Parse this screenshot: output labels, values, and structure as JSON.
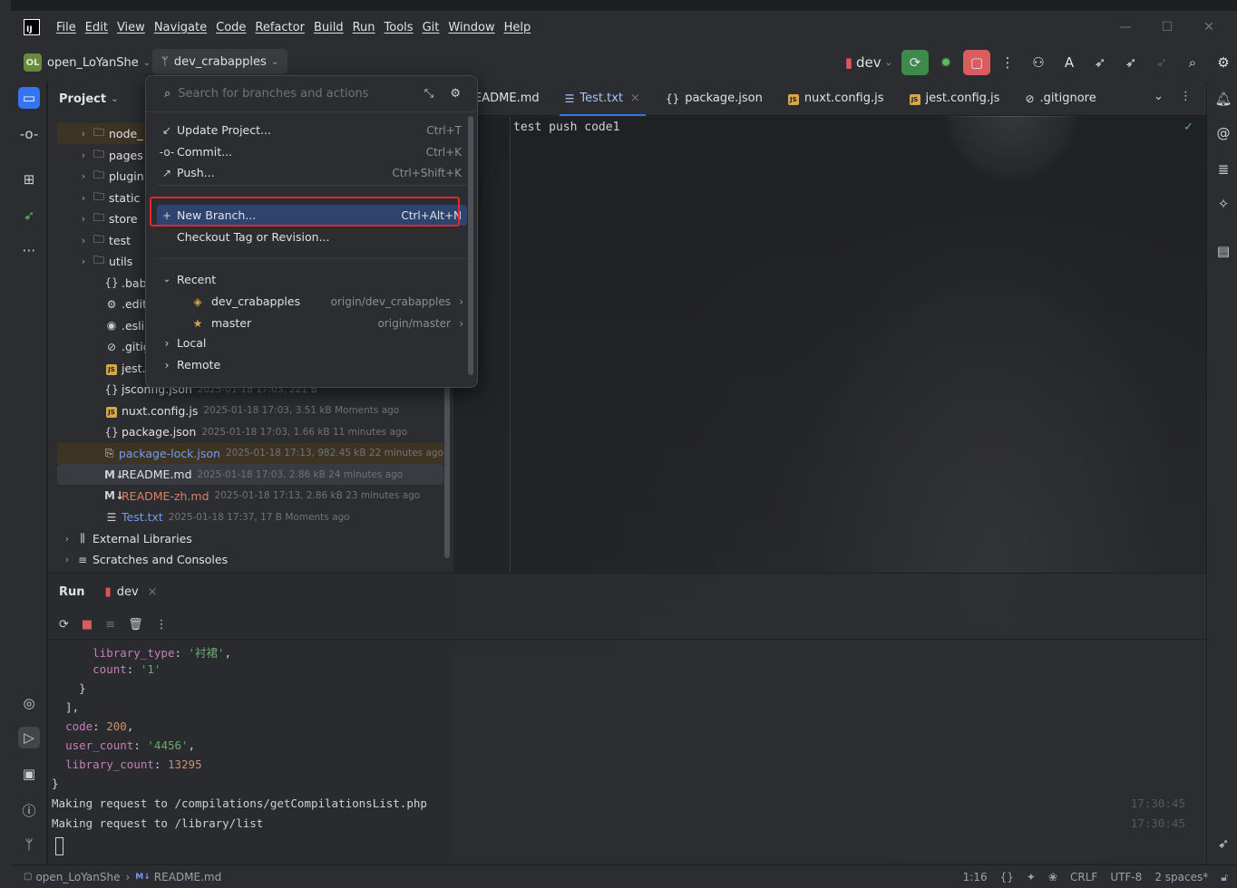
{
  "menu": [
    "File",
    "Edit",
    "View",
    "Navigate",
    "Code",
    "Refactor",
    "Build",
    "Run",
    "Tools",
    "Git",
    "Window",
    "Help"
  ],
  "toolbar": {
    "project_badge": "OL",
    "project_name": "open_LoYanShe",
    "branch_name": "dev_crabapples",
    "run_config": "dev"
  },
  "project_panel": {
    "title": "Project",
    "tree": [
      {
        "name": "node_",
        "icon": "folder-icon",
        "chev": "›",
        "meta": "",
        "hl": true
      },
      {
        "name": "pages",
        "icon": "folder-icon",
        "chev": "›",
        "meta": ""
      },
      {
        "name": "plugin",
        "icon": "folder-icon",
        "chev": "›",
        "meta": ""
      },
      {
        "name": "static",
        "icon": "folder-icon",
        "chev": "›",
        "meta": ""
      },
      {
        "name": "store",
        "icon": "folder-icon",
        "chev": "›",
        "meta": ""
      },
      {
        "name": "test",
        "icon": "folder-icon",
        "chev": "›",
        "meta": ""
      },
      {
        "name": "utils",
        "icon": "folder-icon",
        "chev": "›",
        "meta": ""
      },
      {
        "name": ".babel",
        "icon": "braces-icon",
        "chev": "",
        "meta": ""
      },
      {
        "name": ".editor",
        "icon": "gear-icon",
        "chev": "",
        "meta": ""
      },
      {
        "name": ".eslintr",
        "icon": "eslint-icon",
        "chev": "",
        "meta": ""
      },
      {
        "name": ".gitign",
        "icon": "ignore-icon",
        "chev": "",
        "meta": ""
      },
      {
        "name": "jest.co",
        "icon": "js-icon",
        "chev": "",
        "meta": ""
      },
      {
        "name": "jsconfig.json",
        "icon": "braces-icon",
        "chev": "",
        "meta": "2025-01-18 17:03, 221 B"
      },
      {
        "name": "nuxt.config.js",
        "icon": "js-icon",
        "chev": "",
        "meta": "2025-01-18 17:03, 3.51 kB Moments ago"
      },
      {
        "name": "package.json",
        "icon": "braces-icon",
        "chev": "",
        "meta": "2025-01-18 17:03, 1.66 kB 11 minutes ago"
      },
      {
        "name": "package-lock.json",
        "icon": "lock-json-icon",
        "chev": "",
        "meta": "2025-01-18 17:13, 982.45 kB 22 minutes ago",
        "hl": true,
        "color": "#6f9df5"
      },
      {
        "name": "README.md",
        "icon": "markdown-icon",
        "chev": "",
        "meta": "2025-01-18 17:03, 2.86 kB 24 minutes ago",
        "sel": true
      },
      {
        "name": "README-zh.md",
        "icon": "markdown-icon",
        "chev": "",
        "meta": "2025-01-18 17:13, 2.86 kB 23 minutes ago",
        "color": "#e07f6a"
      },
      {
        "name": "Test.txt",
        "icon": "text-file-icon",
        "chev": "",
        "meta": "2025-01-18 17:37, 17 B Moments ago",
        "color": "#6f9df5"
      },
      {
        "name": "External Libraries",
        "icon": "library-icon",
        "chev": "›",
        "meta": "",
        "root": true
      },
      {
        "name": "Scratches and Consoles",
        "icon": "scratches-icon",
        "chev": "›",
        "meta": "",
        "root": true
      }
    ]
  },
  "editor": {
    "tabs": [
      {
        "label": "README.md",
        "icon": ""
      },
      {
        "label": "Test.txt",
        "icon": "text-file-icon",
        "active": true,
        "closable": true
      },
      {
        "label": "package.json",
        "icon": "braces-icon"
      },
      {
        "label": "nuxt.config.js",
        "icon": "js-icon"
      },
      {
        "label": "jest.config.js",
        "icon": "js-icon"
      },
      {
        "label": ".gitignore",
        "icon": "ignore-icon"
      }
    ],
    "code": "test push code1"
  },
  "popup": {
    "search_placeholder": "Search for branches and actions",
    "items": [
      {
        "label": "Update Project...",
        "shortcut": "Ctrl+T",
        "icon": "update-icon"
      },
      {
        "label": "Commit...",
        "shortcut": "Ctrl+K",
        "icon": "commit-icon"
      },
      {
        "label": "Push...",
        "shortcut": "Ctrl+Shift+K",
        "icon": "push-icon"
      },
      {
        "label": "New Branch...",
        "shortcut": "Ctrl+Alt+N",
        "icon": "plus-icon",
        "sel": true
      },
      {
        "label": "Checkout Tag or Revision...",
        "shortcut": "",
        "icon": ""
      }
    ],
    "recent_label": "Recent",
    "recent": [
      {
        "name": "dev_crabapples",
        "remote": "origin/dev_crabapples",
        "icon": "tag-icon"
      },
      {
        "name": "master",
        "remote": "origin/master",
        "icon": "star-icon"
      }
    ],
    "local_label": "Local",
    "remote_label": "Remote"
  },
  "run_panel": {
    "title": "Run",
    "tab": "dev",
    "timestamps": [
      "17:30:45",
      "17:30:45"
    ],
    "request1": "Making request to /compilations/getCompilationsList.php",
    "request2": "Making request to /library/list"
  },
  "statusbar": {
    "breadcrumb_project": "open_LoYanShe",
    "breadcrumb_file": "README.md",
    "position": "1:16",
    "line_sep": "CRLF",
    "encoding": "UTF-8",
    "indent": "2 spaces*"
  }
}
